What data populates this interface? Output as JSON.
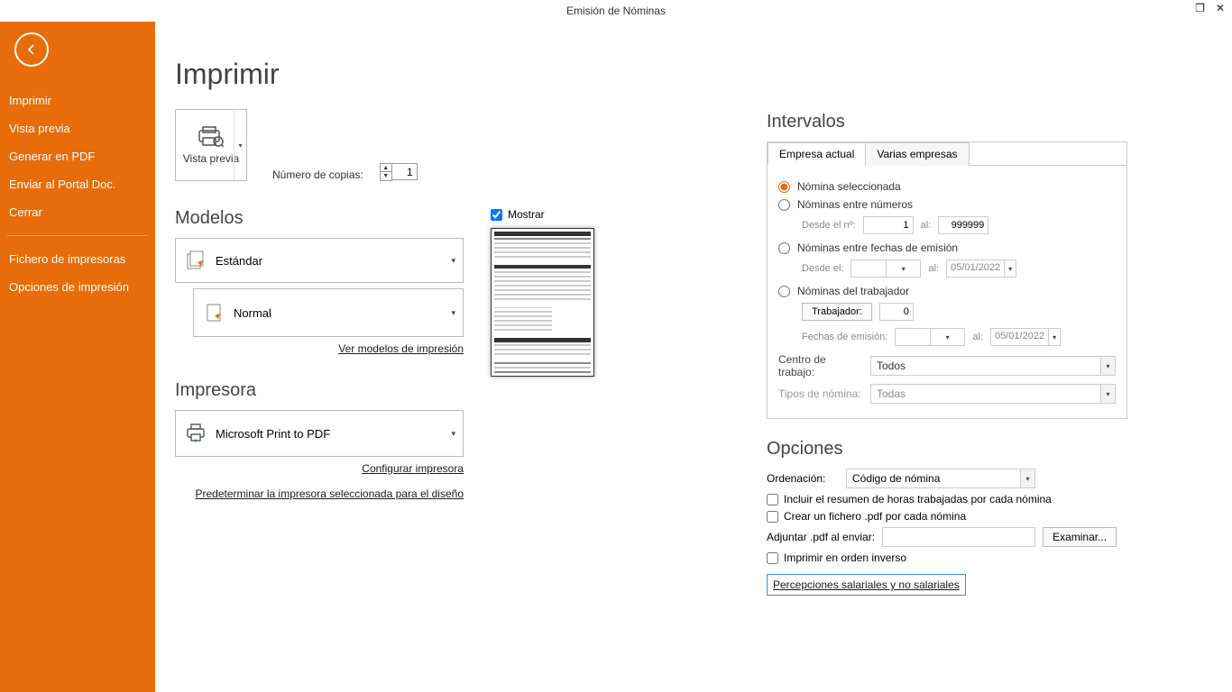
{
  "window": {
    "title": "Emisión de Nóminas"
  },
  "sidebar": {
    "items": [
      "Imprimir",
      "Vista previa",
      "Generar en PDF",
      "Enviar al Portal Doc.",
      "Cerrar"
    ],
    "items2": [
      "Fichero de impresoras",
      "Opciones de impresión"
    ]
  },
  "page": {
    "title": "Imprimir"
  },
  "preview_button": "Vista previa",
  "copies_label": "Número de copias:",
  "copies_value": "1",
  "models": {
    "heading": "Modelos",
    "std": "Estándar",
    "normal": "Normal",
    "link": "Ver modelos de impresión",
    "mostrar_label": "Mostrar",
    "mostrar_checked": true
  },
  "printer": {
    "heading": "Impresora",
    "name": "Microsoft Print to PDF",
    "config_link": "Configurar impresora",
    "default_link": "Predeterminar la impresora seleccionada para el diseño"
  },
  "intervals": {
    "heading": "Intervalos",
    "tab1": "Empresa actual",
    "tab2": "Varias empresas",
    "r1": "Nómina seleccionada",
    "r2": "Nóminas entre números",
    "r2_from_label": "Desde el nº:",
    "r2_from": "1",
    "r2_to_label": "al:",
    "r2_to": "999999",
    "r3": "Nóminas entre fechas de emisión",
    "r3_from_label": "Desde el:",
    "r3_to_label": "al:",
    "r3_to": "05/01/2022",
    "r4": "Nóminas del trabajador",
    "r4_btn": "Trabajador:",
    "r4_val": "0",
    "r4_dates_label": "Fechas de emisión:",
    "r4_to_label": "al:",
    "r4_to": "05/01/2022",
    "centro_label": "Centro de trabajo:",
    "centro_value": "Todos",
    "tipos_label": "Tipos de nómina:",
    "tipos_value": "Todas"
  },
  "options": {
    "heading": "Opciones",
    "orden_label": "Ordenación:",
    "orden_value": "Código de nómina",
    "chk_resumen": "Incluir el resumen de horas trabajadas por cada nómina",
    "chk_pdf": "Crear un fichero .pdf por cada nómina",
    "attach_label": "Adjuntar .pdf al enviar:",
    "browse": "Examinar...",
    "chk_inverso": "Imprimir en orden inverso",
    "percep_link": "Percepciones salariales y no salariales"
  }
}
